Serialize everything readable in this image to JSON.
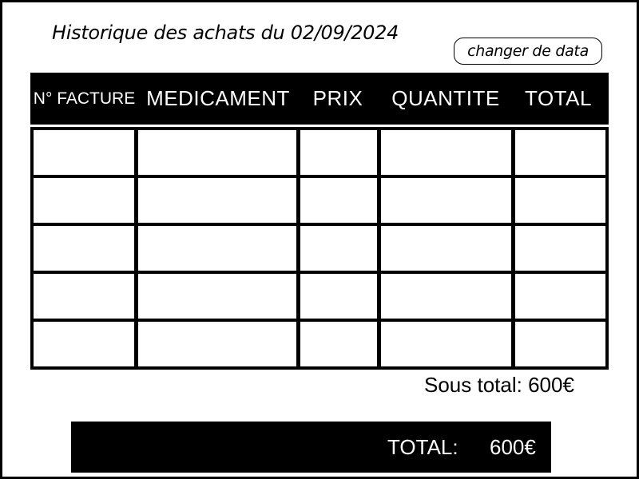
{
  "page": {
    "title": "Historique des achats du 02/09/2024"
  },
  "actions": {
    "change_data_label": "changer de data"
  },
  "table": {
    "headers": [
      "N° FACTURE",
      "MEDICAMENT",
      "PRIX",
      "QUANTITE",
      "TOTAL"
    ],
    "rows": [
      [
        "",
        "",
        "",
        "",
        ""
      ],
      [
        "",
        "",
        "",
        "",
        ""
      ],
      [
        "",
        "",
        "",
        "",
        ""
      ],
      [
        "",
        "",
        "",
        "",
        ""
      ],
      [
        "",
        "",
        "",
        "",
        ""
      ]
    ]
  },
  "summary": {
    "subtotal_text": "Sous total: 600€",
    "total_label": "TOTAL:",
    "total_value": "600€"
  },
  "colors": {
    "background": "#ffffff",
    "header_bar": "#000000",
    "header_text": "#ffffff",
    "grid_lines": "#000000"
  }
}
